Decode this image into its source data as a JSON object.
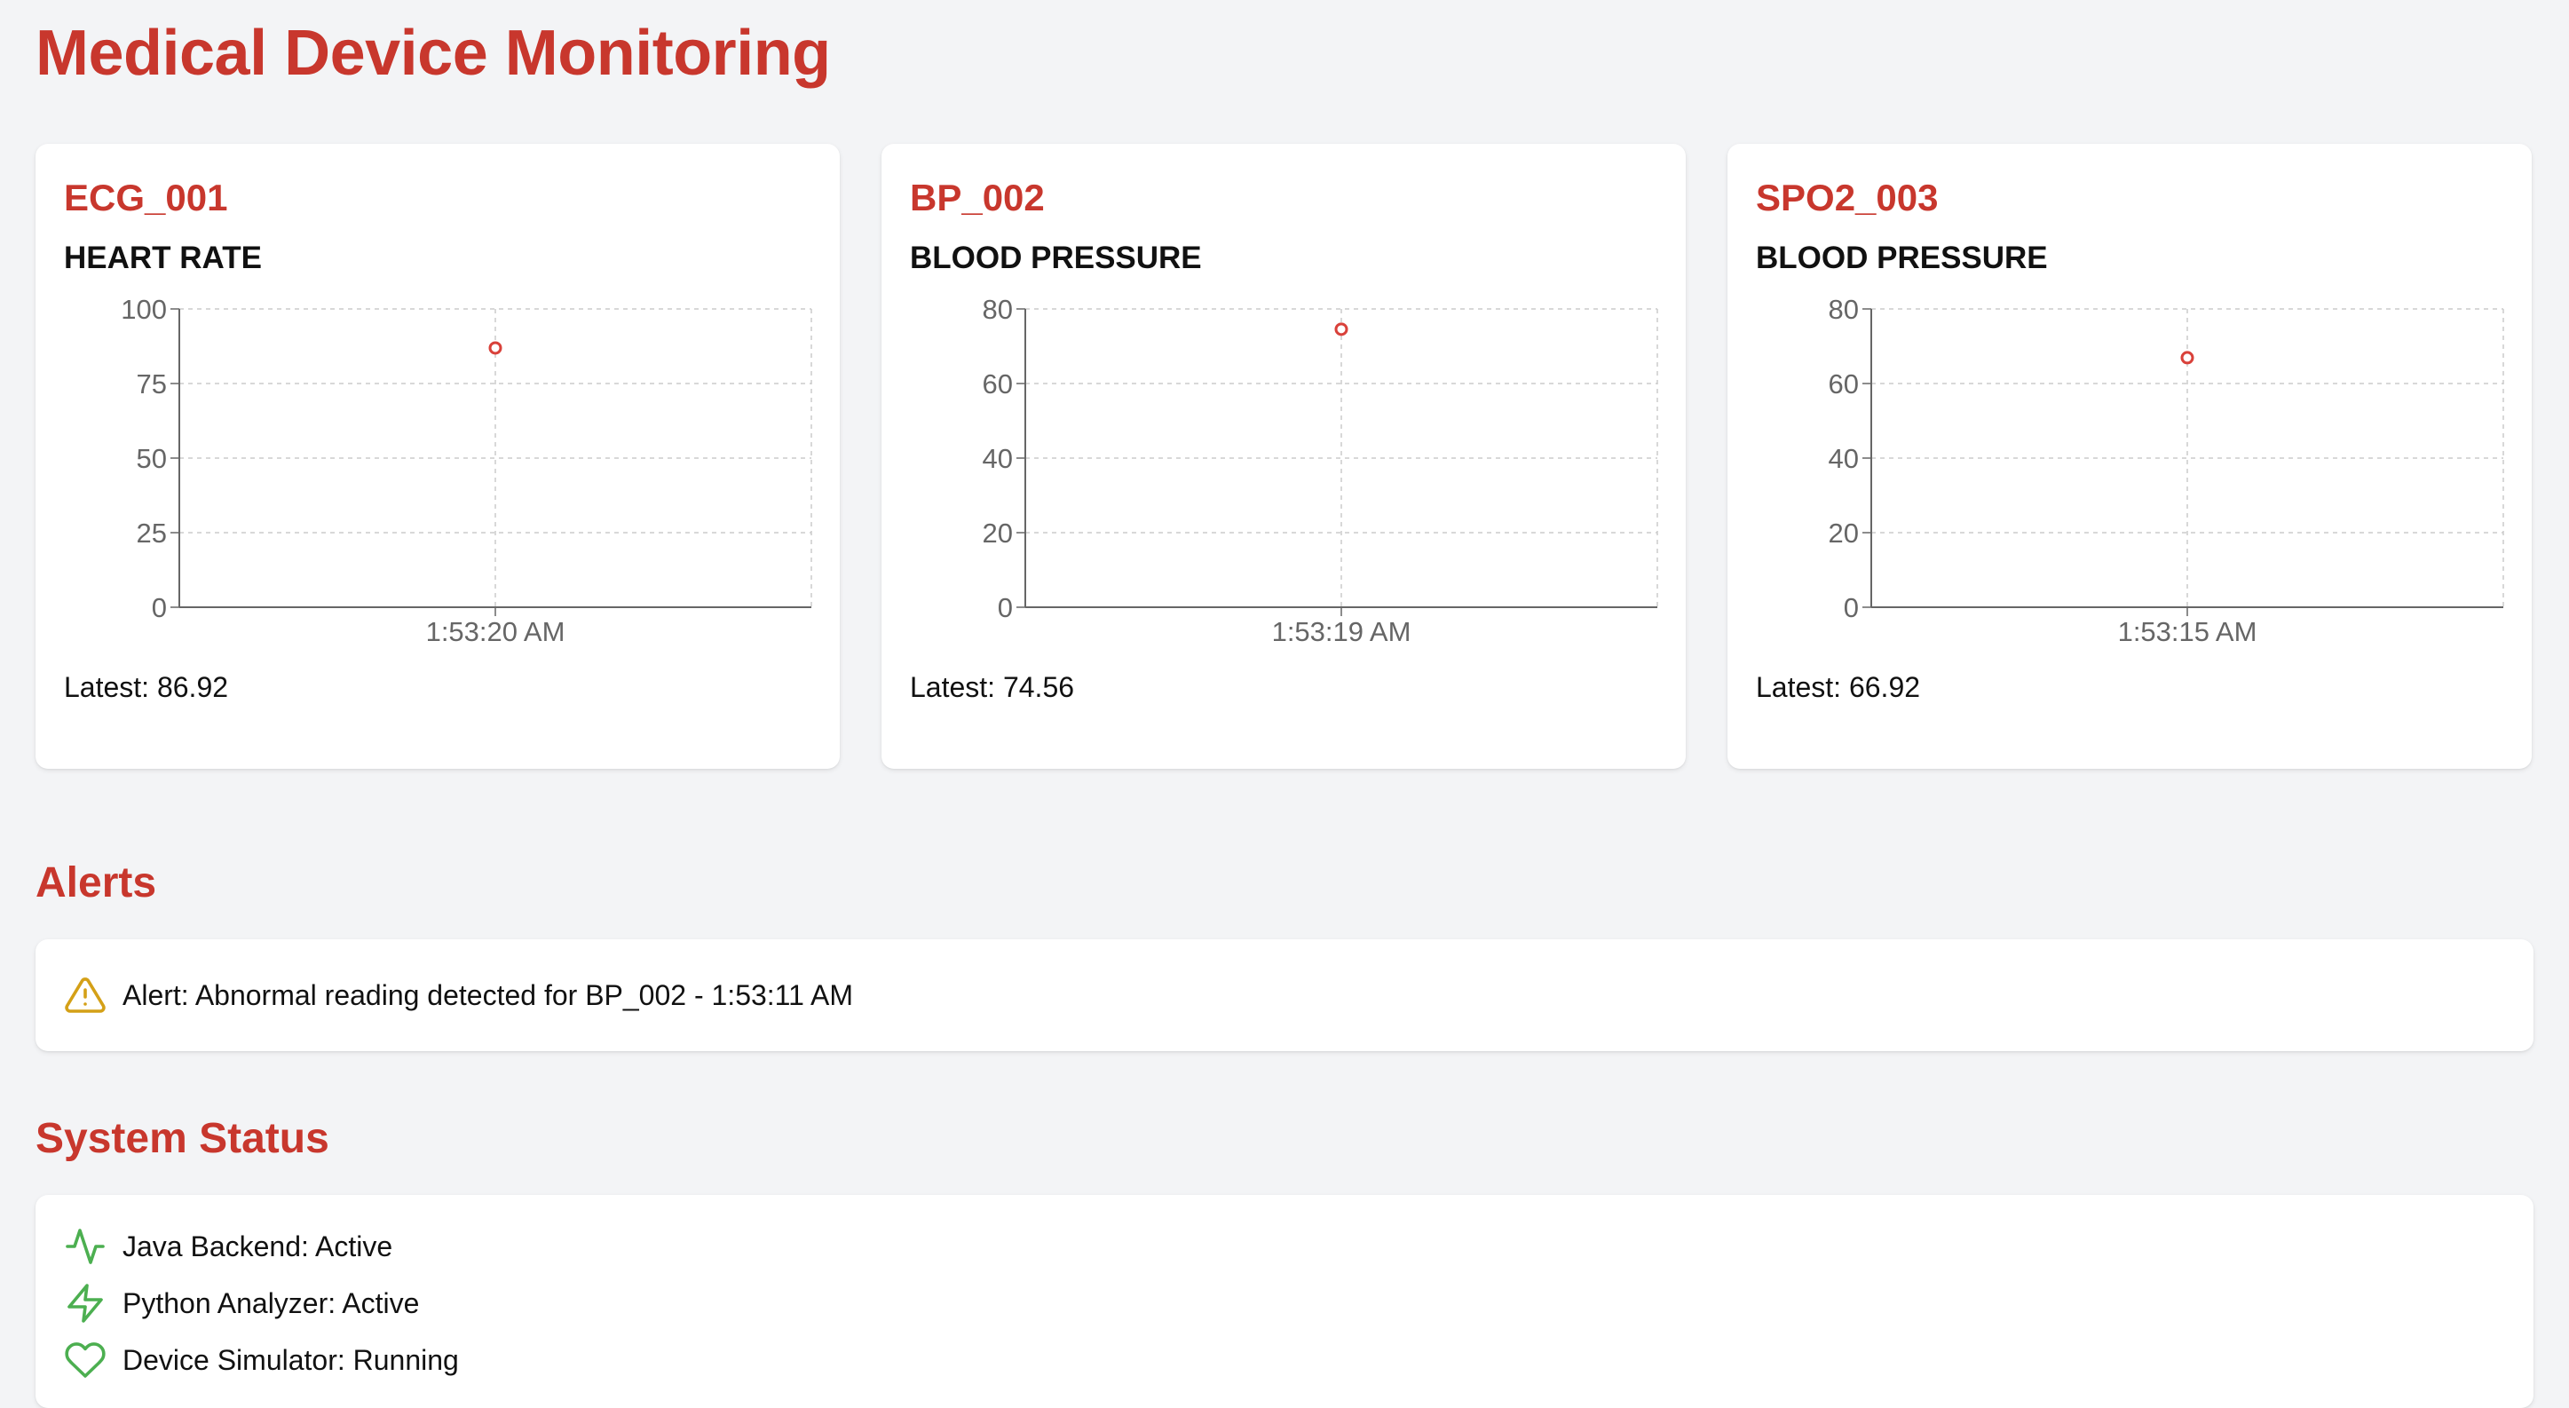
{
  "page": {
    "title": "Medical Device Monitoring"
  },
  "devices": [
    {
      "id": "ECG_001",
      "metric": "HEART RATE",
      "latest_label": "Latest: 86.92",
      "chart_data": {
        "type": "scatter",
        "x": [
          "1:53:20 AM"
        ],
        "values": [
          86.92
        ],
        "ylim": [
          0,
          100
        ],
        "yticks": [
          "0",
          "25",
          "50",
          "75",
          "100"
        ],
        "xticks": [
          "1:53:20 AM"
        ],
        "grid": true,
        "color": "#d9413a"
      }
    },
    {
      "id": "BP_002",
      "metric": "BLOOD PRESSURE",
      "latest_label": "Latest: 74.56",
      "chart_data": {
        "type": "scatter",
        "x": [
          "1:53:19 AM"
        ],
        "values": [
          74.56
        ],
        "ylim": [
          0,
          80
        ],
        "yticks": [
          "0",
          "20",
          "40",
          "60",
          "80"
        ],
        "xticks": [
          "1:53:19 AM"
        ],
        "grid": true,
        "color": "#d9413a"
      }
    },
    {
      "id": "SPO2_003",
      "metric": "BLOOD PRESSURE",
      "latest_label": "Latest: 66.92",
      "chart_data": {
        "type": "scatter",
        "x": [
          "1:53:15 AM"
        ],
        "values": [
          66.92
        ],
        "ylim": [
          0,
          80
        ],
        "yticks": [
          "0",
          "20",
          "40",
          "60",
          "80"
        ],
        "xticks": [
          "1:53:15 AM"
        ],
        "grid": true,
        "color": "#d9413a"
      }
    }
  ],
  "alerts": {
    "title": "Alerts",
    "items": [
      {
        "text": "Alert: Abnormal reading detected for BP_002 - 1:53:11 AM",
        "icon": "warning-icon",
        "color": "#d4a017"
      }
    ]
  },
  "system_status": {
    "title": "System Status",
    "items": [
      {
        "text": "Java Backend: Active",
        "icon": "activity-icon",
        "color": "#4caf50"
      },
      {
        "text": "Python Analyzer: Active",
        "icon": "lightning-icon",
        "color": "#4caf50"
      },
      {
        "text": "Device Simulator: Running",
        "icon": "heart-icon",
        "color": "#4caf50"
      }
    ]
  },
  "theme": {
    "accent": "#c8372d",
    "background": "#f3f4f6",
    "card": "#ffffff"
  }
}
